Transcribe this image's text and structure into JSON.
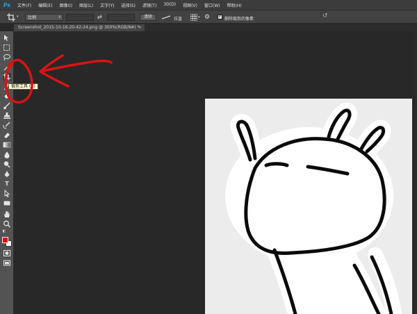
{
  "app": {
    "logo": "Ps"
  },
  "menu": [
    "文件(F)",
    "编辑(E)",
    "图像(I)",
    "图层(L)",
    "文字(Y)",
    "选择(S)",
    "滤镜(T)",
    "3D(D)",
    "视图(V)",
    "窗口(W)",
    "帮助(H)"
  ],
  "options_bar": {
    "ratio_select": "比例",
    "clear_button": "清除",
    "straighten_label": "拉直",
    "delete_cropped_label": "删除裁剪的像素",
    "delete_cropped_checked": true
  },
  "document_tab": {
    "title": "Screenshot_2015-10-16-20-42-24.png @ 300%(RGB/8#) *",
    "close": "×"
  },
  "tooltip": {
    "text": "裁剪工具 (C)"
  },
  "colors": {
    "foreground": "#e01010",
    "background": "#ffffff",
    "annotation": "#d81414"
  }
}
